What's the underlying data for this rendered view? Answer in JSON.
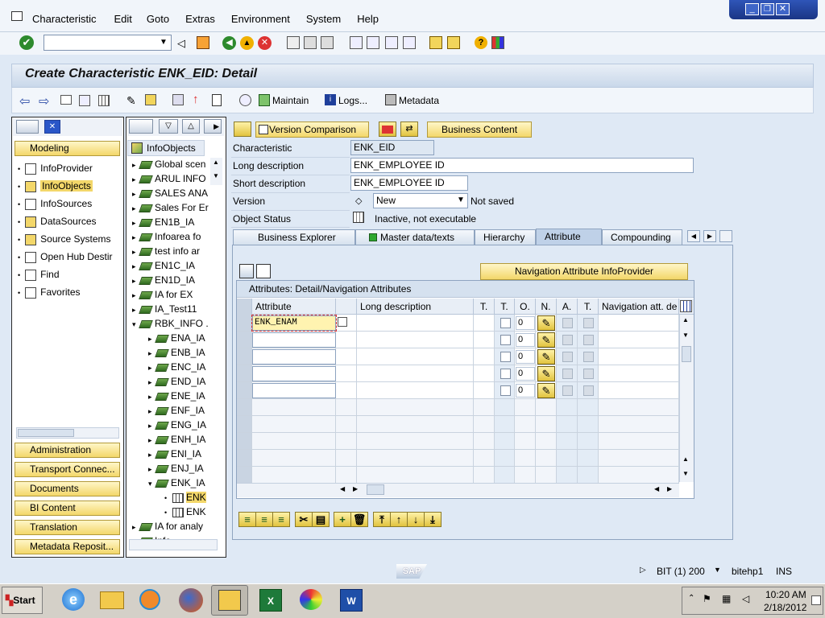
{
  "menu": [
    "Characteristic",
    "Edit",
    "Goto",
    "Extras",
    "Environment",
    "System",
    "Help"
  ],
  "command_field": {
    "value": ""
  },
  "title": "Create Characteristic ENK_EID: Detail",
  "app_toolbar": {
    "maintain": "Maintain",
    "logs": "Logs...",
    "metadata": "Metadata"
  },
  "left_panel": {
    "modeling_label": "Modeling",
    "items": [
      "InfoProvider",
      "InfoObjects",
      "InfoSources",
      "DataSources",
      "Source Systems",
      "Open Hub Destir",
      "Find",
      "Favorites"
    ],
    "bottom_buttons": [
      "Administration",
      "Transport Connec...",
      "Documents",
      "BI Content",
      "Translation",
      "Metadata Reposit..."
    ]
  },
  "tree": {
    "header": "InfoObjects",
    "items": [
      {
        "label": "Global scen",
        "level": 0,
        "tri": "▸"
      },
      {
        "label": "ARUL INFO",
        "level": 0,
        "tri": "▸"
      },
      {
        "label": "SALES ANA",
        "level": 0,
        "tri": "▸"
      },
      {
        "label": "Sales For Er",
        "level": 0,
        "tri": "▸"
      },
      {
        "label": "EN1B_IA",
        "level": 0,
        "tri": "▸"
      },
      {
        "label": "Infoarea fo",
        "level": 0,
        "tri": "▸"
      },
      {
        "label": "test info ar",
        "level": 0,
        "tri": "▸"
      },
      {
        "label": "EN1C_IA",
        "level": 0,
        "tri": "▸"
      },
      {
        "label": "EN1D_IA",
        "level": 0,
        "tri": "▸"
      },
      {
        "label": "IA for EX",
        "level": 0,
        "tri": "▸"
      },
      {
        "label": "IA_Test11",
        "level": 0,
        "tri": "▸"
      },
      {
        "label": "RBK_INFO .",
        "level": 0,
        "tri": "▾"
      },
      {
        "label": "ENA_IA",
        "level": 1,
        "tri": "▸"
      },
      {
        "label": "ENB_IA",
        "level": 1,
        "tri": "▸"
      },
      {
        "label": "ENC_IA",
        "level": 1,
        "tri": "▸"
      },
      {
        "label": "END_IA",
        "level": 1,
        "tri": "▸"
      },
      {
        "label": "ENE_IA",
        "level": 1,
        "tri": "▸"
      },
      {
        "label": "ENF_IA",
        "level": 1,
        "tri": "▸"
      },
      {
        "label": "ENG_IA",
        "level": 1,
        "tri": "▸"
      },
      {
        "label": "ENH_IA",
        "level": 1,
        "tri": "▸"
      },
      {
        "label": "ENI_IA",
        "level": 1,
        "tri": "▸"
      },
      {
        "label": "ENJ_IA",
        "level": 1,
        "tri": "▸"
      },
      {
        "label": "ENK_IA",
        "level": 1,
        "tri": "▾"
      },
      {
        "label": "ENK",
        "level": 2,
        "tri": "•"
      },
      {
        "label": "ENK",
        "level": 2,
        "tri": "•"
      },
      {
        "label": "IA for analy",
        "level": 0,
        "tri": "▸"
      },
      {
        "label": "Info",
        "level": 0,
        "tri": "▸"
      }
    ]
  },
  "detail_toolbar": {
    "version_comparison": "Version Comparison",
    "business_content": "Business Content"
  },
  "form": {
    "characteristic_label": "Characteristic",
    "characteristic_value": "ENK_EID",
    "long_desc_label": "Long description",
    "long_desc_value": "ENK_EMPLOYEE ID",
    "short_desc_label": "Short description",
    "short_desc_value": "ENK_EMPLOYEE ID",
    "version_label": "Version",
    "version_value": "New",
    "version_status": "Not saved",
    "object_status_label": "Object Status",
    "object_status_value": "Inactive, not executable"
  },
  "tabs": [
    "Business Explorer",
    "Master data/texts",
    "Hierarchy",
    "Attribute",
    "Compounding"
  ],
  "active_tab": "Attribute",
  "nav_attr_button": "Navigation Attribute InfoProvider",
  "grid": {
    "title": "Attributes: Detail/Navigation Attributes",
    "columns": [
      "Attribute",
      "Long description",
      "T.",
      "T.",
      "O.",
      "N.",
      "A.",
      "T.",
      "Navigation att. de"
    ],
    "rows": [
      {
        "attribute": "ENK_ENAM",
        "order": "0"
      },
      {
        "attribute": "",
        "order": "0"
      },
      {
        "attribute": "",
        "order": "0"
      },
      {
        "attribute": "",
        "order": "0"
      },
      {
        "attribute": "",
        "order": "0"
      }
    ]
  },
  "status_bar": {
    "system": "BIT (1) 200",
    "host": "bitehp1",
    "mode": "INS"
  },
  "taskbar": {
    "start": "Start",
    "time": "10:20 AM",
    "date": "2/18/2012"
  },
  "colors": {
    "accent": "#f3d76a",
    "background": "#dfe9f5",
    "taskbar": "#d4d0c8"
  }
}
